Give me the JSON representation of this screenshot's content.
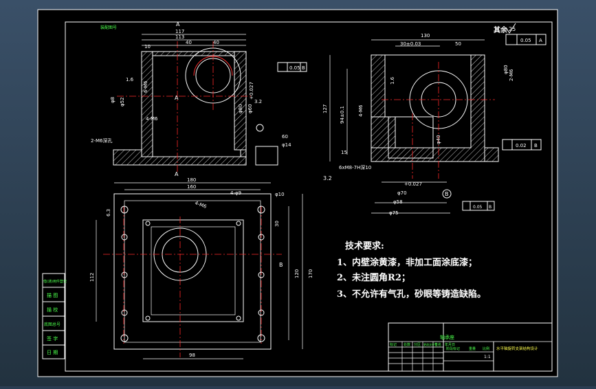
{
  "sheet": {
    "corner_mark": "其余",
    "corner_roughness": "25",
    "top_left_label": "装配图号"
  },
  "front_view": {
    "dims": [
      "117",
      "113",
      "10",
      "40",
      "40",
      "6-M6",
      "φ52",
      "φ8",
      "φ80",
      "φ60",
      "φ14",
      "60",
      "2-M6深孔",
      "4-M6",
      "1.6",
      "3.2"
    ],
    "section_marks": [
      "A",
      "A",
      "A"
    ],
    "tolerance": "+0.027",
    "datum_ref": [
      "0.05",
      "B"
    ]
  },
  "side_view": {
    "dims": [
      "130",
      "30±0.03",
      "50",
      "2-M6",
      "φ80",
      "94±0.1",
      "127",
      "4-M6",
      "15",
      "6xM8-7H深10",
      "+0.027",
      "φ70",
      "φ58",
      "φ75",
      "φ40",
      "3.2",
      "1.6"
    ],
    "datum_b": "B",
    "flatness": [
      "0.05",
      "A"
    ],
    "parallel": [
      "0.02",
      "B"
    ],
    "position_ref": [
      "0.05",
      "B"
    ]
  },
  "top_view": {
    "dims": [
      "180",
      "160",
      "4-φ9",
      "4-M6",
      "φ10",
      "30",
      "112",
      "120",
      "170",
      "98",
      "6.3"
    ],
    "section_mark": "B"
  },
  "notes": {
    "heading": "技术要求:",
    "items": [
      "1、内壁涂黄漆，非加工面涂底漆；",
      "2、未注圆角R2；",
      "3、不允许有气孔，砂眼等铸造缺陷。"
    ]
  },
  "left_table": {
    "rows": [
      "借(通)用件登记",
      "描 图",
      "描 校",
      "底图总号",
      "签 字",
      "日 期"
    ]
  },
  "title_block": {
    "drawing_title": "水平轴旋转支架结构设计",
    "part_name": "轴承座",
    "header_cells": [
      "标记",
      "处数",
      "分区",
      "更改文件号",
      "签名",
      "年月日"
    ],
    "stage_cells": [
      "阶段标记",
      "重量",
      "比例"
    ],
    "ratio": "1:1"
  }
}
